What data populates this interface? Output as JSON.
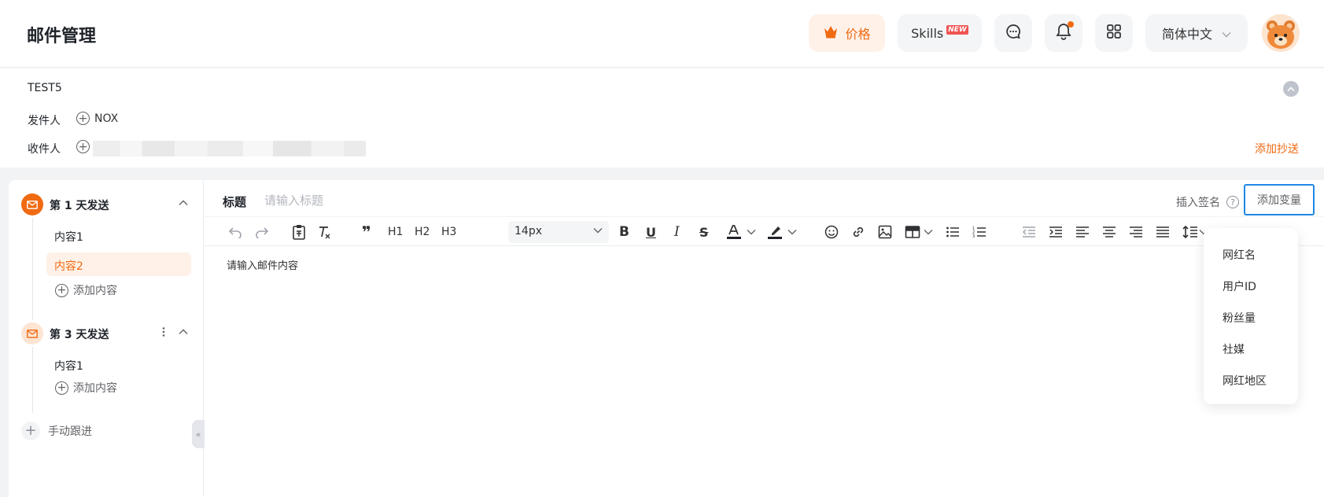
{
  "app": {
    "title": "邮件管理"
  },
  "header": {
    "price_label": "价格",
    "skills_label": "Skills",
    "skills_badge": "NEW",
    "language_label": "简体中文"
  },
  "email": {
    "title": "TEST5",
    "sender_label": "发件人",
    "sender_value": "NOX",
    "recipient_label": "收件人",
    "add_cc_label": "添加抄送"
  },
  "sequence": {
    "steps": [
      {
        "label": "第 1 天发送",
        "contents": [
          "内容1",
          "内容2"
        ],
        "active_content": "内容2",
        "add_label": "添加内容"
      },
      {
        "label": "第 3 天发送",
        "contents": [
          "内容1"
        ],
        "add_label": "添加内容"
      }
    ],
    "manual_follow_label": "手动跟进"
  },
  "editor": {
    "subject_label": "标题",
    "subject_placeholder": "请输入标题",
    "insert_signature_label": "插入签名",
    "add_variable_label": "添加变量",
    "font_size": "14px",
    "heading_buttons": [
      "H1",
      "H2",
      "H3"
    ],
    "body_placeholder": "请输入邮件内容"
  },
  "variable_menu": {
    "items": [
      "网红名",
      "用户ID",
      "粉丝量",
      "社媒",
      "网红地区"
    ]
  },
  "colors": {
    "accent": "#f06a12",
    "focus": "#1e88e5"
  }
}
